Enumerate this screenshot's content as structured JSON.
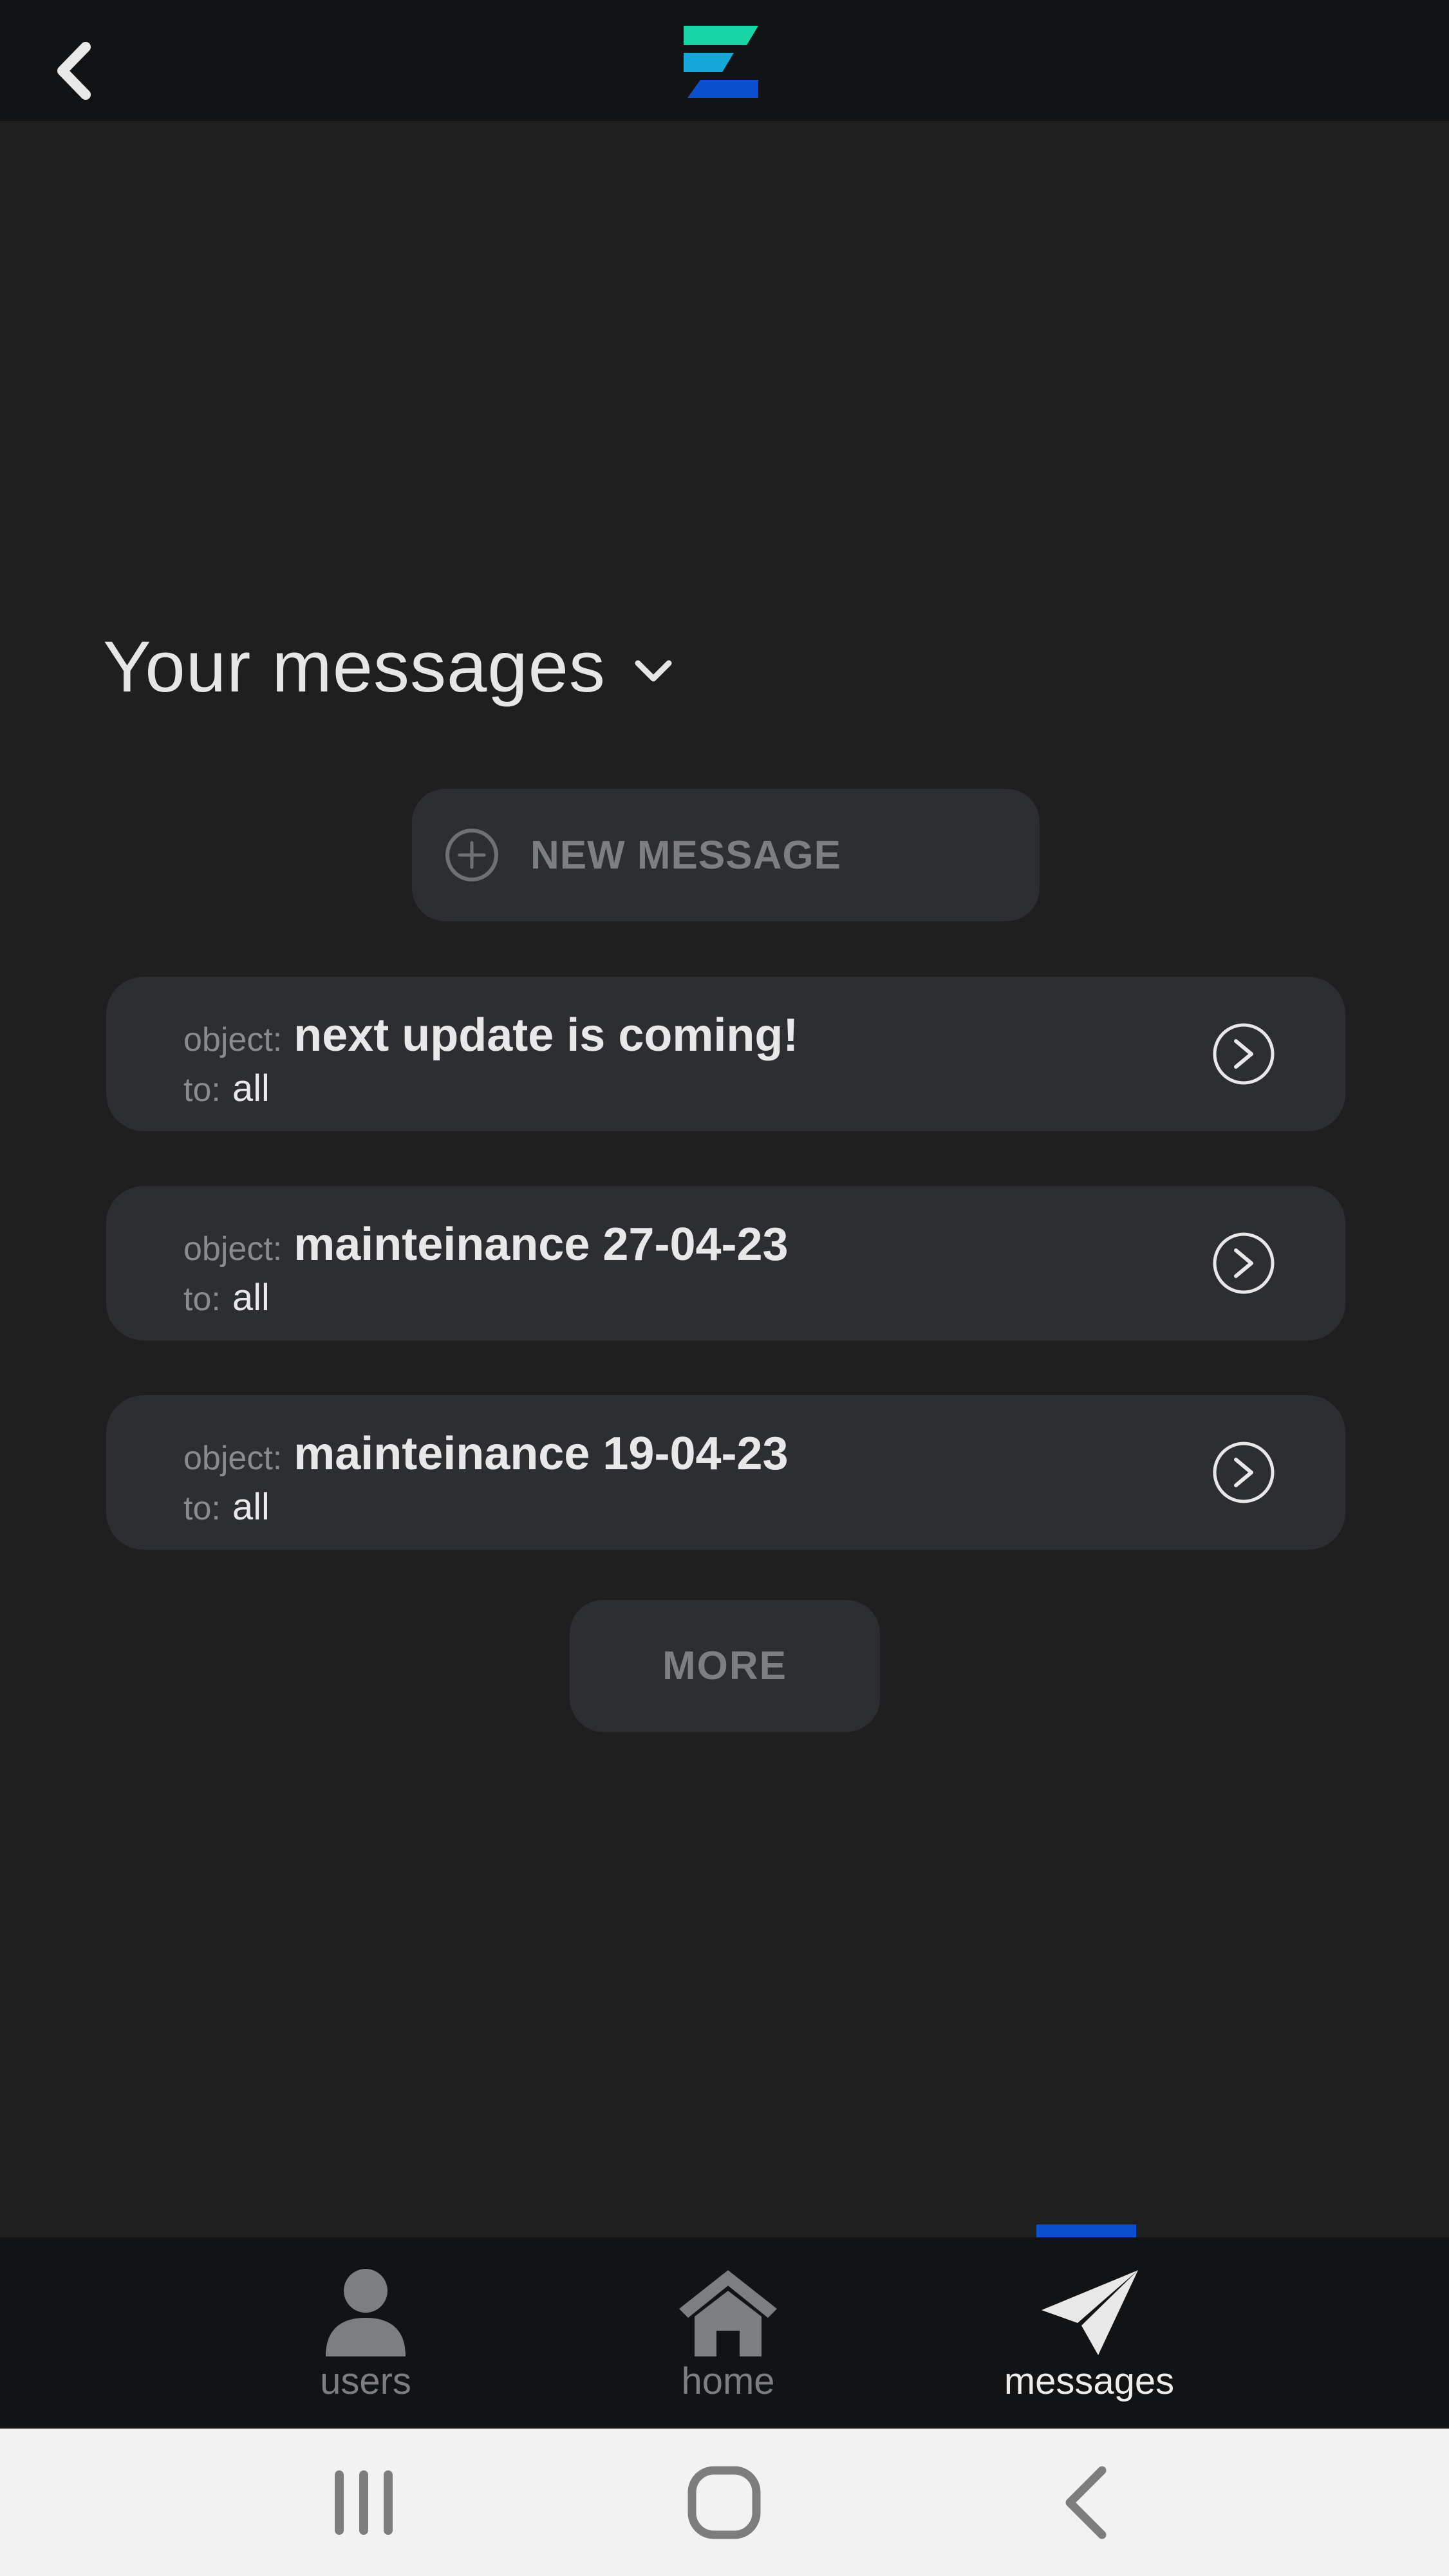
{
  "header": {
    "back_icon": "chevron-left-icon",
    "logo_icon": "app-logo",
    "colors": {
      "background": "#121315",
      "logo_teal": "#1ad6a6",
      "logo_cyan": "#16a8d8",
      "logo_blue": "#0a4fcf"
    }
  },
  "main": {
    "title": "Your messages",
    "title_icon": "chevron-down-icon",
    "new_message_label": "NEW MESSAGE",
    "new_message_icon": "plus-circle-icon",
    "messages": [
      {
        "object_label": "object:",
        "subject": "next update is coming!",
        "to_label": "to:",
        "recipient": "all",
        "action_icon": "arrow-right-circle-icon"
      },
      {
        "object_label": "object:",
        "subject": "mainteinance 27-04-23",
        "to_label": "to:",
        "recipient": "all",
        "action_icon": "arrow-right-circle-icon"
      },
      {
        "object_label": "object:",
        "subject": "mainteinance 19-04-23",
        "to_label": "to:",
        "recipient": "all",
        "action_icon": "arrow-right-circle-icon"
      }
    ],
    "more_label": "MORE"
  },
  "tabbar": {
    "active": "messages",
    "accent": "#0a4fcf",
    "tabs": [
      {
        "key": "users",
        "label": "users",
        "icon": "user-icon"
      },
      {
        "key": "home",
        "label": "home",
        "icon": "home-icon"
      },
      {
        "key": "messages",
        "label": "messages",
        "icon": "send-icon"
      }
    ]
  },
  "system_nav": {
    "buttons": [
      "recent-apps-icon",
      "home-circle-icon",
      "back-arrow-icon"
    ]
  }
}
